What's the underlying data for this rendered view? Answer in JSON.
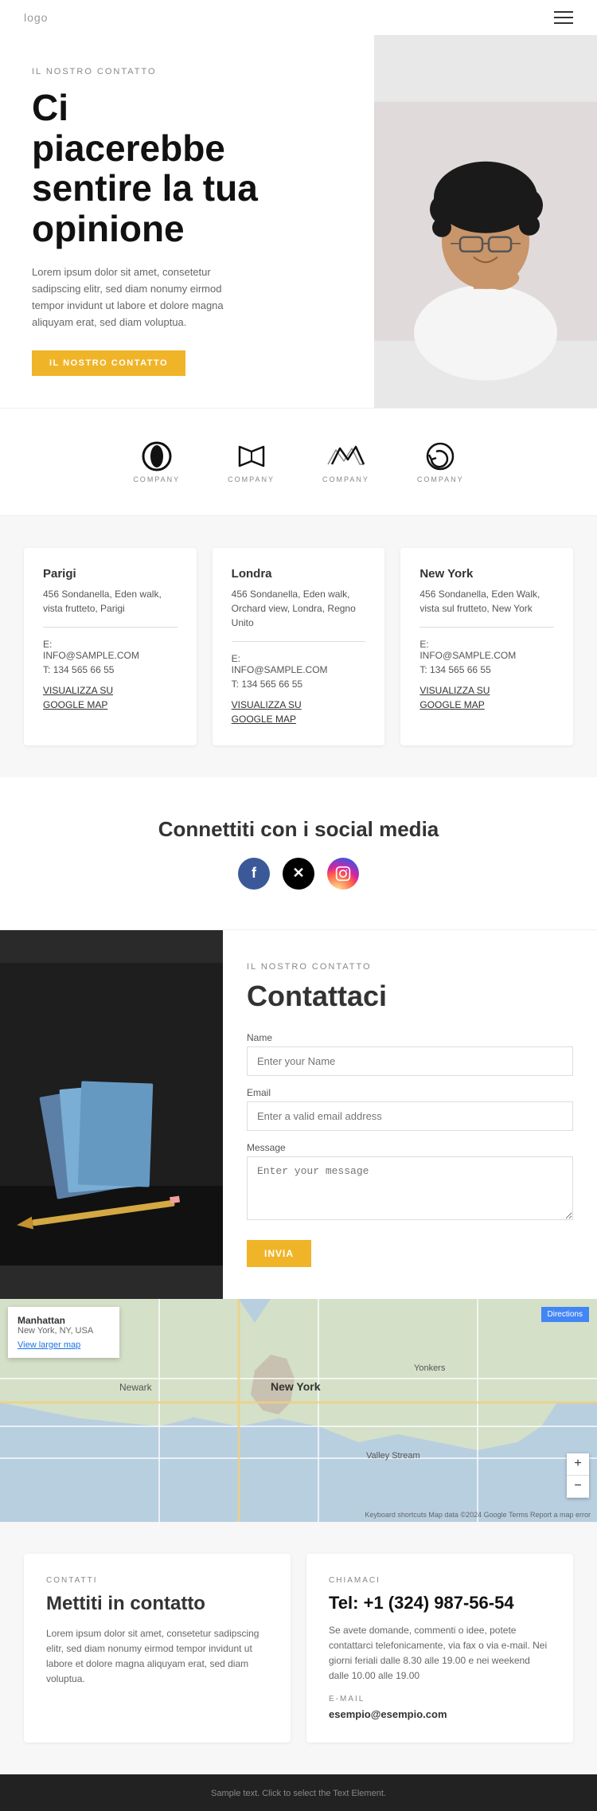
{
  "header": {
    "logo": "logo",
    "menu_icon": "≡"
  },
  "hero": {
    "label": "IL NOSTRO CONTATTO",
    "title_line1": "Ci",
    "title_line2": "piacerebbe",
    "title_line3": "sentire la tua",
    "title_line4": "opinione",
    "description": "Lorem ipsum dolor sit amet, consetetur sadipscing elitr, sed diam nonumy eirmod tempor invidunt ut labore et dolore magna aliquyam erat, sed diam voluptua.",
    "cta_button": "IL NOSTRO CONTATTO"
  },
  "logos": [
    {
      "name": "company-logo-1",
      "label": "COMPANY"
    },
    {
      "name": "company-logo-2",
      "label": "COMPANY"
    },
    {
      "name": "company-logo-3",
      "label": "COMPANY"
    },
    {
      "name": "company-logo-4",
      "label": "COMPANY"
    }
  ],
  "offices": [
    {
      "city": "Parigi",
      "address": "456 Sondanella, Eden walk, vista frutteto, Parigi",
      "email_label": "E:",
      "email": "INFO@SAMPLE.COM",
      "phone_label": "T:",
      "phone": "134 565 66 55",
      "map_link_line1": "VISUALIZZA SU",
      "map_link_line2": "GOOGLE MAP"
    },
    {
      "city": "Londra",
      "address": "456 Sondanella, Eden walk, Orchard view, Londra, Regno Unito",
      "email_label": "E:",
      "email": "INFO@SAMPLE.COM",
      "phone_label": "T:",
      "phone": "134 565 66 55",
      "map_link_line1": "VISUALIZZA SU",
      "map_link_line2": "GOOGLE MAP"
    },
    {
      "city": "New York",
      "address": "456 Sondanella, Eden Walk, vista sul frutteto, New York",
      "email_label": "E:",
      "email": "INFO@SAMPLE.COM",
      "phone_label": "T:",
      "phone": "134 565 66 55",
      "map_link_line1": "VISUALIZZA SU",
      "map_link_line2": "GOOGLE MAP"
    }
  ],
  "social": {
    "title": "Connettiti con i social media",
    "icons": [
      "f",
      "𝕏",
      "📷"
    ]
  },
  "contact_form": {
    "label": "IL NOSTRO CONTATTO",
    "title": "Contattaci",
    "name_label": "Name",
    "name_placeholder": "Enter your Name",
    "email_label": "Email",
    "email_placeholder": "Enter a valid email address",
    "message_label": "Message",
    "message_placeholder": "Enter your message",
    "submit_button": "INVIA"
  },
  "map": {
    "city": "Manhattan",
    "state": "New York, NY, USA",
    "directions": "Directions",
    "view_larger": "View larger map",
    "attribution": "Keyboard shortcuts  Map data ©2024 Google  Terms  Report a map error"
  },
  "bottom_contact": {
    "left": {
      "label": "CONTATTI",
      "title": "Mettiti in contatto",
      "description": "Lorem ipsum dolor sit amet, consetetur sadipscing elitr, sed diam nonumy eirmod tempor invidunt ut labore et dolore magna aliquyam erat, sed diam voluptua."
    },
    "right": {
      "label": "CHIAMACI",
      "phone": "Tel: +1 (324) 987-56-54",
      "call_desc": "Se avete domande, commenti o idee, potete contattarci telefonicamente, via fax o via e-mail. Nei giorni feriali dalle 8.30 alle 19.00 e nei weekend dalle 10.00 alle 19.00",
      "email_section_label": "E-MAIL",
      "email": "esempio@esempio.com"
    }
  },
  "footer": {
    "text": "Sample text. Click to select the Text Element."
  }
}
